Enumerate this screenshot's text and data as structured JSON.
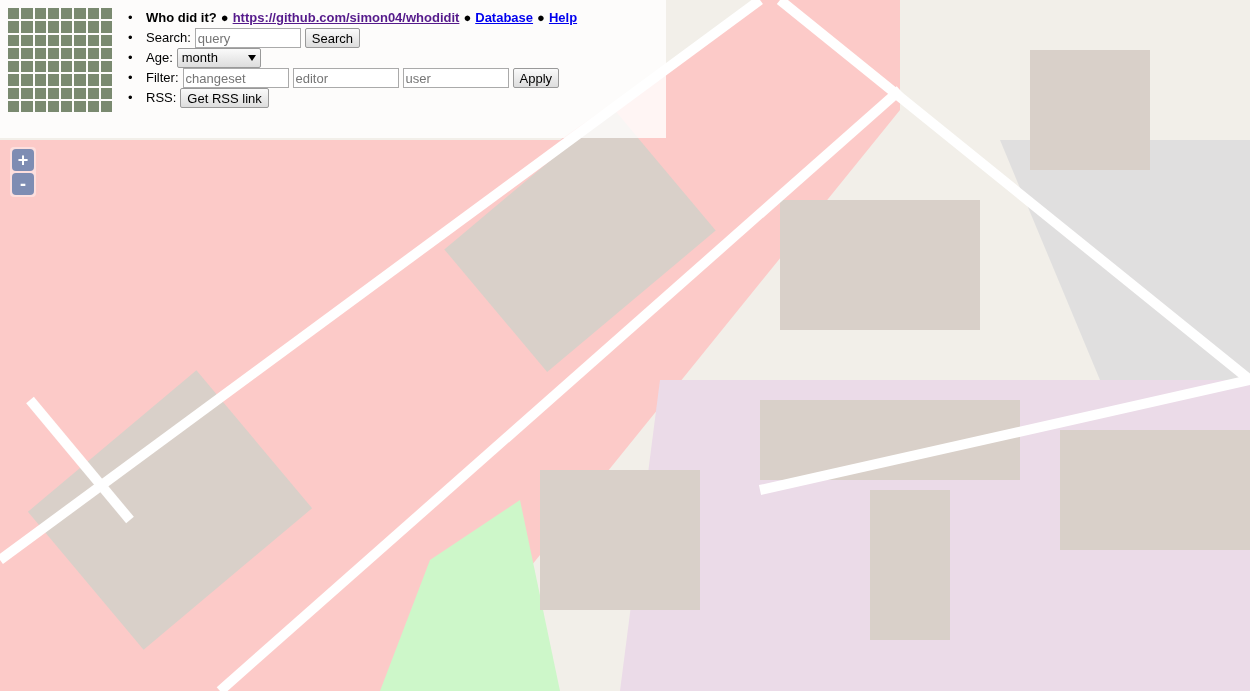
{
  "header": {
    "bullet": "•",
    "items": [
      {
        "kind": "title",
        "text": "Who did it?"
      },
      {
        "kind": "separator",
        "text": "●"
      },
      {
        "kind": "link",
        "text": "https://github.com/simon04/whodidit",
        "visited": true
      },
      {
        "kind": "separator",
        "text": "●"
      },
      {
        "kind": "link",
        "text": "Database",
        "visited": false
      },
      {
        "kind": "separator",
        "text": "●"
      },
      {
        "kind": "link",
        "text": "Help",
        "visited": false
      }
    ]
  },
  "controls": [
    {
      "bullet": "•",
      "label": "Search:",
      "items": [
        {
          "kind": "input",
          "placeholder": "query"
        },
        {
          "kind": "button",
          "text": "Search"
        }
      ]
    },
    {
      "bullet": "•",
      "label": "Age:",
      "items": [
        {
          "kind": "select",
          "value": "month"
        }
      ]
    },
    {
      "bullet": "•",
      "label": "Filter:",
      "items": [
        {
          "kind": "input",
          "placeholder": "changeset"
        },
        {
          "kind": "input",
          "placeholder": "editor"
        },
        {
          "kind": "input",
          "placeholder": "user"
        },
        {
          "kind": "button",
          "text": "Apply"
        }
      ]
    },
    {
      "bullet": "•",
      "label": "RSS:",
      "items": [
        {
          "kind": "button",
          "text": "Get RSS link"
        }
      ]
    }
  ],
  "zoom": {
    "in": "+",
    "out": "-"
  }
}
